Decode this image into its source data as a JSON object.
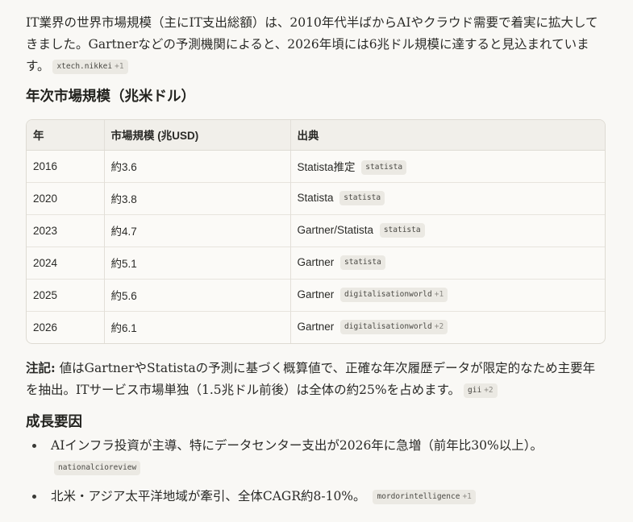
{
  "intro": {
    "text": "IT業界の世界市場規模（主にIT支出総額）は、2010年代半ばからAIやクラウド需要で着実に拡大してきました。Gartnerなどの予測機関によると、2026年頃には6兆ドル規模に達すると見込まれています。",
    "cite": "xtech.nikkei",
    "cite_more": "+1"
  },
  "section1": {
    "title": "年次市場規模（兆米ドル）"
  },
  "table": {
    "headers": [
      "年",
      "市場規模 (兆USD)",
      "出典"
    ],
    "rows": [
      {
        "year": "2016",
        "size": "約3.6",
        "source": "Statista推定",
        "cite": "statista",
        "more": ""
      },
      {
        "year": "2020",
        "size": "約3.8",
        "source": "Statista",
        "cite": "statista",
        "more": ""
      },
      {
        "year": "2023",
        "size": "約4.7",
        "source": "Gartner/Statista",
        "cite": "statista",
        "more": ""
      },
      {
        "year": "2024",
        "size": "約5.1",
        "source": "Gartner",
        "cite": "statista",
        "more": ""
      },
      {
        "year": "2025",
        "size": "約5.6",
        "source": "Gartner",
        "cite": "digitalisationworld",
        "more": "+1"
      },
      {
        "year": "2026",
        "size": "約6.1",
        "source": "Gartner",
        "cite": "digitalisationworld",
        "more": "+2"
      }
    ]
  },
  "note": {
    "label": "注記:",
    "text": " 値はGartnerやStatistaの予測に基づく概算値で、正確な年次履歴データが限定的なため主要年を抽出。ITサービス市場単独（1.5兆ドル前後）は全体の約25%を占めます。",
    "cite": "gii",
    "cite_more": "+2"
  },
  "section2": {
    "title": "成長要因"
  },
  "factors": [
    {
      "text": "AIインフラ投資が主導、特にデータセンター支出が2026年に急増（前年比30%以上）。",
      "cite": "nationalcioreview",
      "more": ""
    },
    {
      "text": "北米・アジア太平洋地域が牽引、全体CAGR約8-10%。",
      "cite": "mordorintelligence",
      "more": "+1"
    }
  ]
}
